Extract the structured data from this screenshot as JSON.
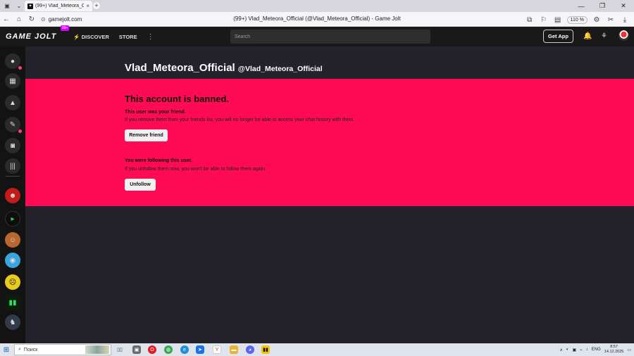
{
  "browser": {
    "tab_title": "(99+) Vlad_Meteora_Of...",
    "tab_favicon": "gj",
    "url": "gamejolt.com",
    "page_title": "(99+) Vlad_Meteora_Official (@Vlad_Meteora_Official) - Game Jolt",
    "zoom": "110 %",
    "profile_badge": "V"
  },
  "gamejolt": {
    "logo": "GAME JOLT",
    "logo_badge": "99+",
    "nav": {
      "discover": "DISCOVER",
      "store": "STORE"
    },
    "search_placeholder": "Search",
    "get_app": "Get App"
  },
  "profile": {
    "display_name": "Vlad_Meteora_Official",
    "handle": "@Vlad_Meteora_Official"
  },
  "banned": {
    "title": "This account is banned.",
    "friend_heading": "This user was your friend.",
    "friend_text": "If you remove them from your friends list, you will no longer be able to access your chat history with them.",
    "remove_friend": "Remove friend",
    "follow_heading": "You were following this user.",
    "follow_text": "If you unfollow them now, you won't be able to follow them again.",
    "unfollow": "Unfollow"
  },
  "taskbar": {
    "search_placeholder": "Поиск",
    "lang": "ENG",
    "time": "8:57",
    "date": "14.12.2025"
  },
  "colors": {
    "banned_bg": "#ff0a55",
    "page_bg": "#24222a",
    "nav_bg": "#191919",
    "accent": "#d800ff"
  }
}
